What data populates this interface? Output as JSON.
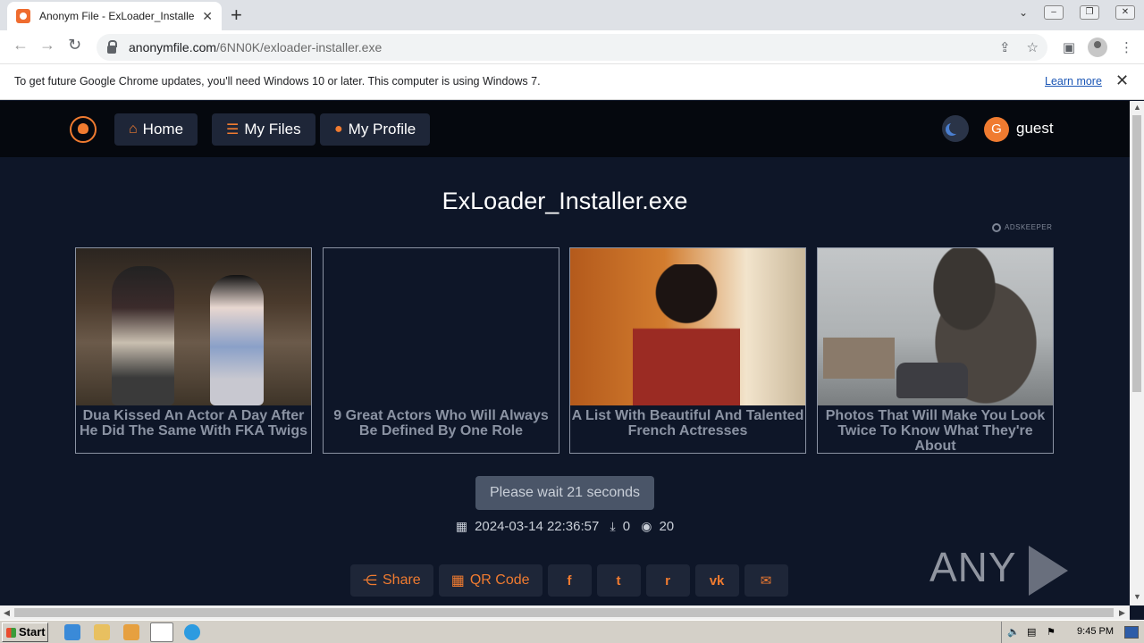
{
  "browser": {
    "tab_title": "Anonym File - ExLoader_Installer.exe",
    "tab_close": "✕",
    "new_tab": "+",
    "url_host": "anonymfile.com",
    "url_path": "/6NN0K/exloader-installer.exe",
    "back": "←",
    "forward": "→",
    "reload": "↻"
  },
  "infobar": {
    "message": "To get future Google Chrome updates, you'll need Windows 10 or later. This computer is using Windows 7.",
    "link": "Learn more",
    "close": "✕"
  },
  "site_nav": {
    "home": "Home",
    "my_files": "My Files",
    "my_profile": "My Profile",
    "avatar_letter": "G",
    "username": "guest"
  },
  "file": {
    "title": "ExLoader_Installer.exe",
    "wait_label": "Please wait 21 seconds",
    "date": "2024-03-14 22:36:57",
    "downloads": "0",
    "views": "20"
  },
  "ads": {
    "provider": "ADSKEEPER",
    "items": [
      {
        "title": "Dua Kissed An Actor A Day After He Did The Same With FKA Twigs"
      },
      {
        "title": "9 Great Actors Who Will Always Be Defined By One Role"
      },
      {
        "title": "A List With Beautiful And Talented French Actresses"
      },
      {
        "title": "Photos That Will Make You Look Twice To Know What They're About"
      }
    ]
  },
  "share": {
    "share_label": "Share",
    "qr_label": "QR Code",
    "facebook": "f",
    "twitter": "t",
    "reddit": "r",
    "vk": "vk",
    "email": "✉"
  },
  "watermark": {
    "left": "ANY",
    "right": "RUN"
  },
  "taskbar": {
    "start": "Start",
    "time": "9:45 PM"
  },
  "colors": {
    "accent": "#f07b30",
    "page_bg": "#0e1628",
    "nav_bg": "#05080e"
  }
}
